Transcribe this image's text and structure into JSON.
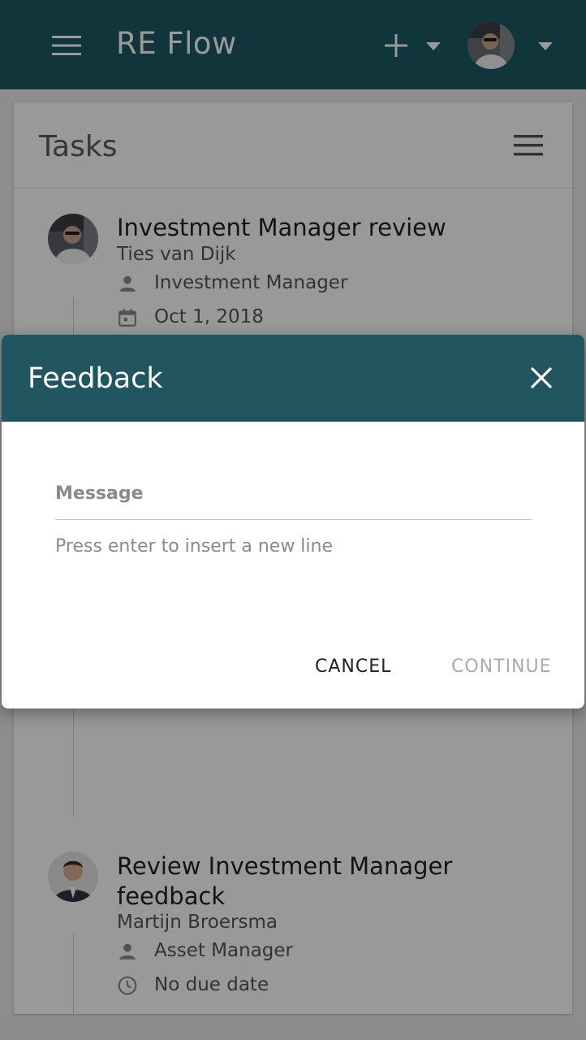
{
  "appbar": {
    "title": "RE Flow",
    "menu_icon": "hamburger-menu-icon",
    "add_icon": "plus-icon",
    "caret_icon": "caret-down-icon",
    "background": "#1c5a63"
  },
  "tasks_card": {
    "title": "Tasks",
    "menu_icon": "list-menu-icon",
    "items": [
      {
        "title": "Investment Manager review",
        "assignee": "Ties van Dijk",
        "role": "Investment Manager",
        "role_icon": "person-icon",
        "date": "Oct 1, 2018",
        "date_icon": "calendar-icon"
      },
      {
        "title": "Review Investment Manager feedback",
        "assignee": "Martijn Broersma",
        "role": "Asset Manager",
        "role_icon": "person-icon",
        "date": "No due date",
        "date_icon": "clock-icon"
      }
    ]
  },
  "dialog": {
    "title": "Feedback",
    "close_icon": "close-icon",
    "message_label": "Message",
    "message_value": "",
    "hint": "Press enter to insert a new line",
    "cancel_label": "CANCEL",
    "continue_label": "CONTINUE",
    "header_color": "#215560"
  }
}
